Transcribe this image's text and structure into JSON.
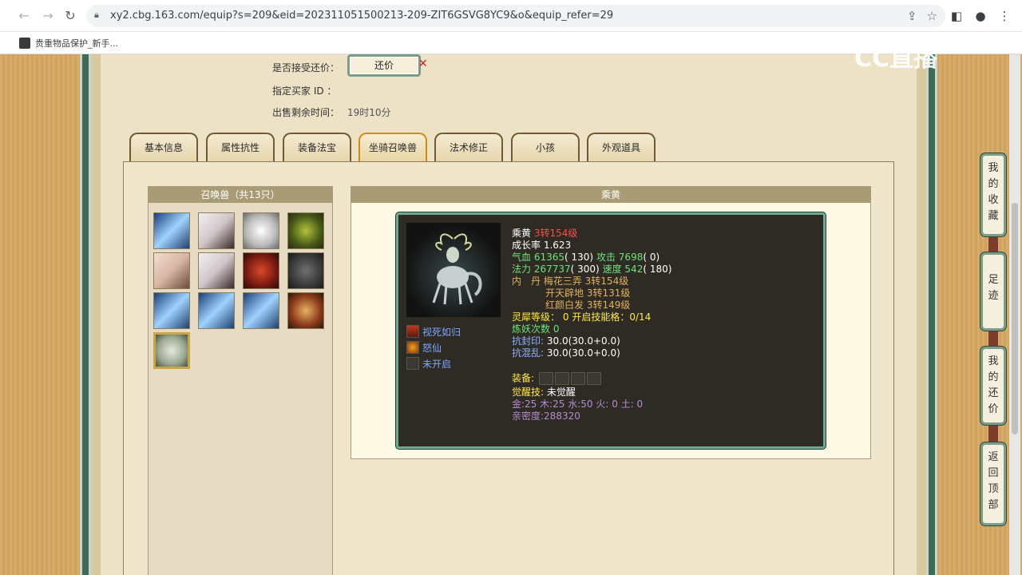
{
  "browser": {
    "url": "xy2.cbg.163.com/equip?s=209&eid=202311051500213-209-ZIT6GSVG8YC9&o&equip_refer=29",
    "bookmark_label": "贵重物品保护_新手..."
  },
  "info": {
    "counter_offer_label": "是否接受还价：",
    "counter_offer_button": "还价",
    "buyer_id_label": "指定买家 ID ：",
    "time_left_label": "出售剩余时间：",
    "time_left_value": "19时10分"
  },
  "tabs": [
    "基本信息",
    "属性抗性",
    "装备法宝",
    "坐骑召唤兽",
    "法术修正",
    "小孩",
    "外观道具"
  ],
  "summon_list": {
    "title": "召唤兽（共13只）"
  },
  "detail": {
    "title": "乘黄",
    "name": "乘黄",
    "level": "3转154级",
    "growth_label": "成长率",
    "growth_value": "1.623",
    "hp_label": "气血",
    "hp_value": "61365",
    "hp_extra": "( 130)",
    "atk_label": "攻击",
    "atk_value": "7698",
    "atk_extra": "( 0)",
    "mp_label": "法力",
    "mp_value": "267737",
    "mp_extra": "( 300)",
    "spd_label": "速度",
    "spd_value": "542",
    "spd_extra": "( 180)",
    "neidan_label": "内　丹",
    "neidan": [
      "梅花三弄 3转154级",
      "开天辟地 3转131级",
      "红颜白发 3转149级"
    ],
    "lingxi_label": "灵犀等级：",
    "lingxi_value": "0",
    "open_slots_label": "开启技能格：",
    "open_slots_value": "0/14",
    "lianyao_label": "炼妖次数",
    "lianyao_value": "0",
    "kangfeng_label": "抗封印:",
    "kangfeng_value": "30.0(30.0+0.0)",
    "kanghun_label": "抗混乱:",
    "kanghun_value": "30.0(30.0+0.0)",
    "equip_label": "装备:",
    "awaken_label": "觉醒技:",
    "awaken_value": "未觉醒",
    "elements": "金:25 木:25 水:50 火: 0 土: 0",
    "intimacy": "亲密度:288320",
    "skills": [
      "视死如归",
      "怒仙",
      "未开启"
    ]
  },
  "side_nav": {
    "favorites": "我的收藏",
    "footprints": "足迹",
    "my_counters": "我的还价",
    "back_top": "返回顶部"
  },
  "watermark": "CC直播"
}
